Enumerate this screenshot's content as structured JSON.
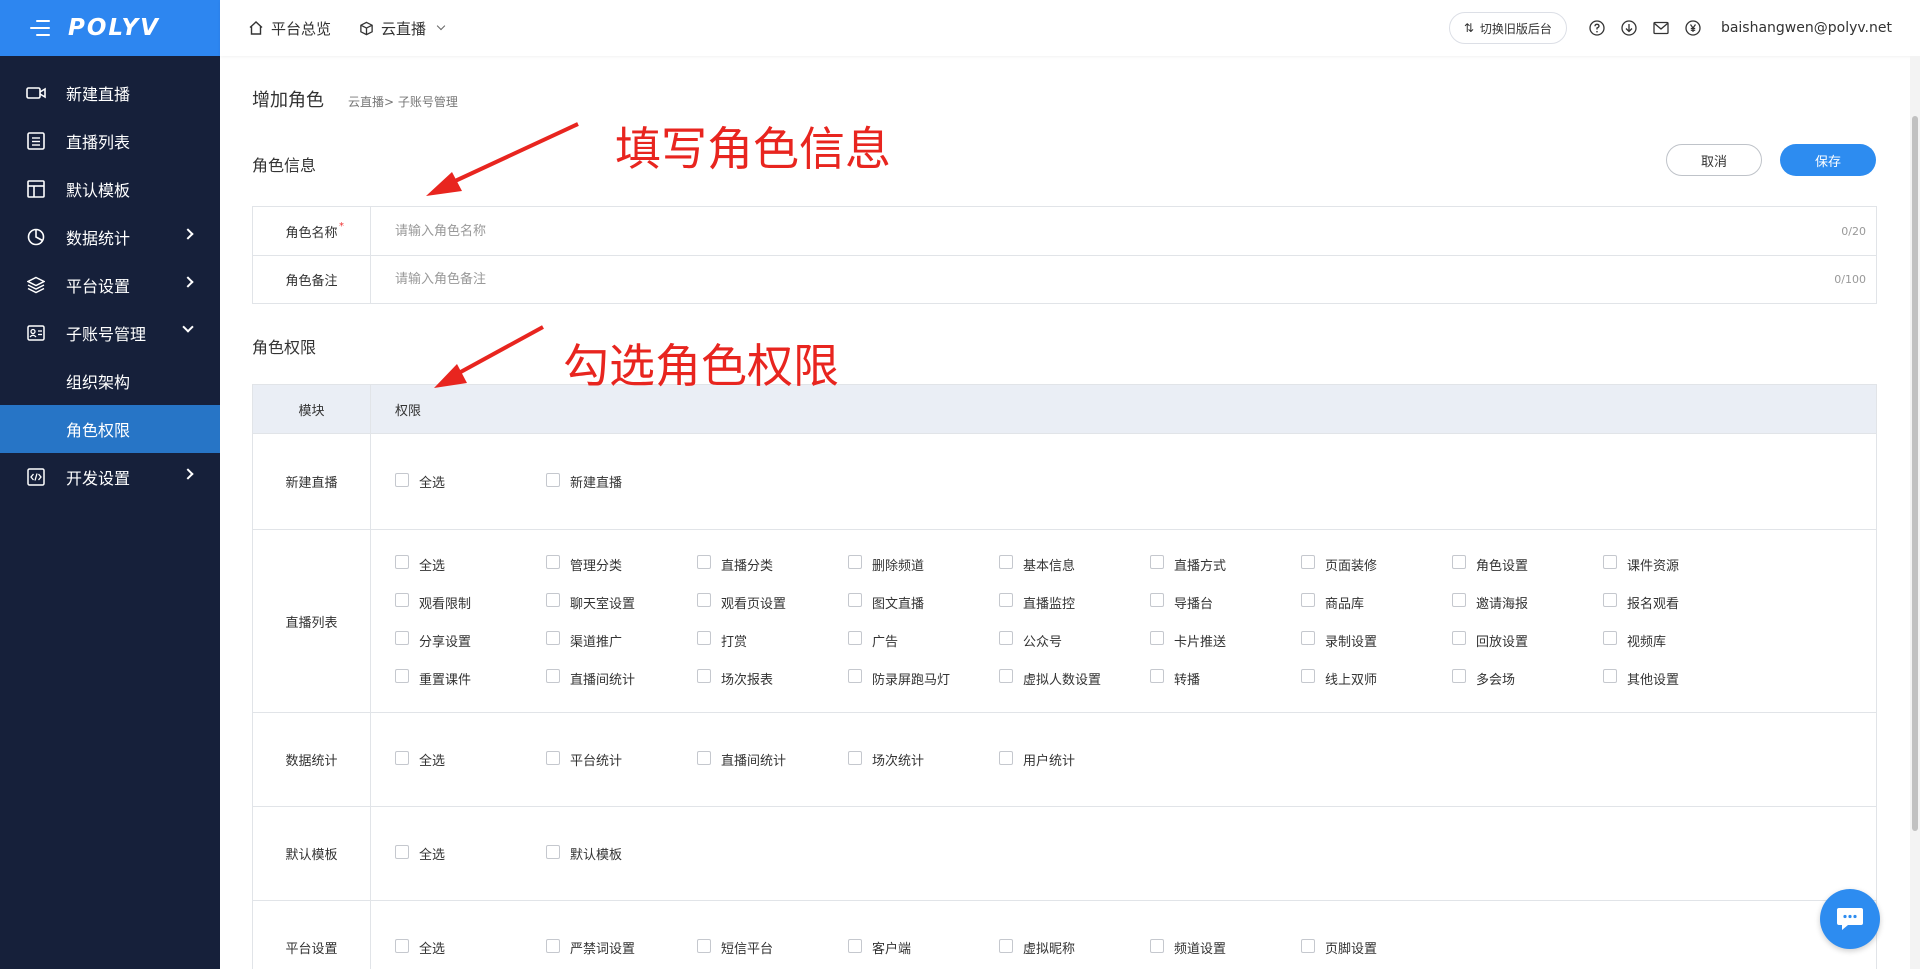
{
  "brand": {
    "logo": "POLYV",
    "primary": "#2d8cf0",
    "sidebar_bg": "#16203a",
    "logo_bg": "#2d86f0",
    "active_bg": "#2775c6",
    "annotation": "#e8251f"
  },
  "sidebar": {
    "items": [
      {
        "label": "新建直播",
        "icon": "video-camera-icon"
      },
      {
        "label": "直播列表",
        "icon": "list-icon"
      },
      {
        "label": "默认模板",
        "icon": "layout-icon"
      },
      {
        "label": "数据统计",
        "icon": "pie-chart-icon"
      },
      {
        "label": "平台设置",
        "icon": "layers-icon"
      },
      {
        "label": "子账号管理",
        "icon": "id-card-icon"
      },
      {
        "label": "开发设置",
        "icon": "code-icon"
      }
    ],
    "sub_items": [
      {
        "label": "组织架构"
      },
      {
        "label": "角色权限"
      }
    ]
  },
  "header": {
    "nav": [
      {
        "label": "平台总览",
        "icon": "home-icon"
      },
      {
        "label": "云直播",
        "icon": "cube-icon"
      }
    ],
    "old_version_label": "切换旧版后台",
    "user_email": "baishangwen@polyv.net"
  },
  "page": {
    "title": "增加角色",
    "breadcrumb": "云直播> 子账号管理",
    "role_info_title": "角色信息",
    "permission_title": "角色权限",
    "cancel_label": "取消",
    "save_label": "保存"
  },
  "form": {
    "name_label": "角色名称",
    "name_required": "*",
    "name_placeholder": "请输入角色名称",
    "name_value": "",
    "name_count": "0/20",
    "remark_label": "角色备注",
    "remark_placeholder": "请输入角色备注",
    "remark_value": "",
    "remark_count": "0/100"
  },
  "permissions": {
    "header_module": "模块",
    "header_perm": "权限",
    "modules": [
      {
        "name": "新建直播",
        "options": [
          "全选",
          "新建直播"
        ]
      },
      {
        "name": "直播列表",
        "options": [
          "全选",
          "管理分类",
          "直播分类",
          "删除频道",
          "基本信息",
          "直播方式",
          "页面装修",
          "角色设置",
          "课件资源",
          "观看限制",
          "聊天室设置",
          "观看页设置",
          "图文直播",
          "直播监控",
          "导播台",
          "商品库",
          "邀请海报",
          "报名观看",
          "分享设置",
          "渠道推广",
          "打赏",
          "广告",
          "公众号",
          "卡片推送",
          "录制设置",
          "回放设置",
          "视频库",
          "重置课件",
          "直播间统计",
          "场次报表",
          "防录屏跑马灯",
          "虚拟人数设置",
          "转播",
          "线上双师",
          "多会场",
          "其他设置"
        ]
      },
      {
        "name": "数据统计",
        "options": [
          "全选",
          "平台统计",
          "直播间统计",
          "场次统计",
          "用户统计"
        ]
      },
      {
        "name": "默认模板",
        "options": [
          "全选",
          "默认模板"
        ]
      },
      {
        "name": "平台设置",
        "options": [
          "全选",
          "严禁词设置",
          "短信平台",
          "客户端",
          "虚拟昵称",
          "频道设置",
          "页脚设置"
        ]
      }
    ]
  },
  "annotations": {
    "fill_info": "填写角色信息",
    "check_perm": "勾选角色权限"
  }
}
